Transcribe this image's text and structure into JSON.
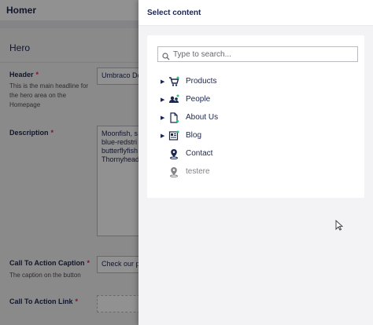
{
  "editor": {
    "node_name": "Homer",
    "group_title": "Hero",
    "properties": [
      {
        "label": "Header",
        "required": true,
        "description": "This is the main headline for the hero area on the Homepage",
        "value": "Umbraco De"
      },
      {
        "label": "Description",
        "required": true,
        "description": "",
        "value": "Moonfish, s blue-redstri butterflyfish Thornyhead"
      },
      {
        "label": "Call To Action Caption",
        "required": true,
        "description": "The caption on the button",
        "value": "Check our p"
      },
      {
        "label": "Call To Action Link",
        "required": true,
        "description": "",
        "value": ""
      }
    ],
    "required_marker": "*"
  },
  "dialog": {
    "title": "Select content",
    "search_placeholder": "Type to search...",
    "tree": [
      {
        "label": "Products",
        "icon": "shopping-cart-icon",
        "has_children": true,
        "muted": false
      },
      {
        "label": "People",
        "icon": "people-icon",
        "has_children": true,
        "muted": false
      },
      {
        "label": "About Us",
        "icon": "document-icon",
        "has_children": true,
        "muted": false
      },
      {
        "label": "Blog",
        "icon": "newspaper-icon",
        "has_children": true,
        "muted": false
      },
      {
        "label": "Contact",
        "icon": "map-pin-icon",
        "has_children": false,
        "muted": false
      },
      {
        "label": "testere",
        "icon": "map-pin-icon",
        "has_children": false,
        "muted": true
      }
    ]
  },
  "colors": {
    "primary_text": "#1b264f",
    "required": "#d42054",
    "status_green": "#2bc37c"
  }
}
